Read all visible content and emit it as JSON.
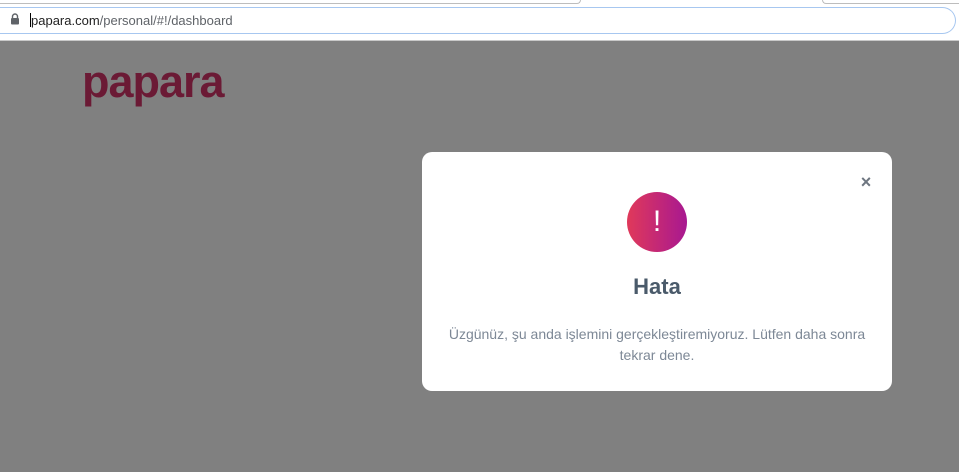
{
  "browser": {
    "url_host": "papara.com",
    "url_path": "/personal/#!/dashboard"
  },
  "header": {
    "logo_text": "papara"
  },
  "dialog": {
    "close_symbol": "×",
    "icon_symbol": "!",
    "title": "Hata",
    "message": "Üzgünüz, şu anda işlemini gerçekleştiremiyoruz. Lütfen daha sonra tekrar dene."
  },
  "colors": {
    "overlay": "#808080",
    "brand": "#6b1a35",
    "alert_gradient_start": "#e0395a",
    "alert_gradient_end": "#a81891"
  },
  "icons": {
    "lock": "lock-icon",
    "close": "close-icon",
    "alert": "exclamation-icon"
  }
}
